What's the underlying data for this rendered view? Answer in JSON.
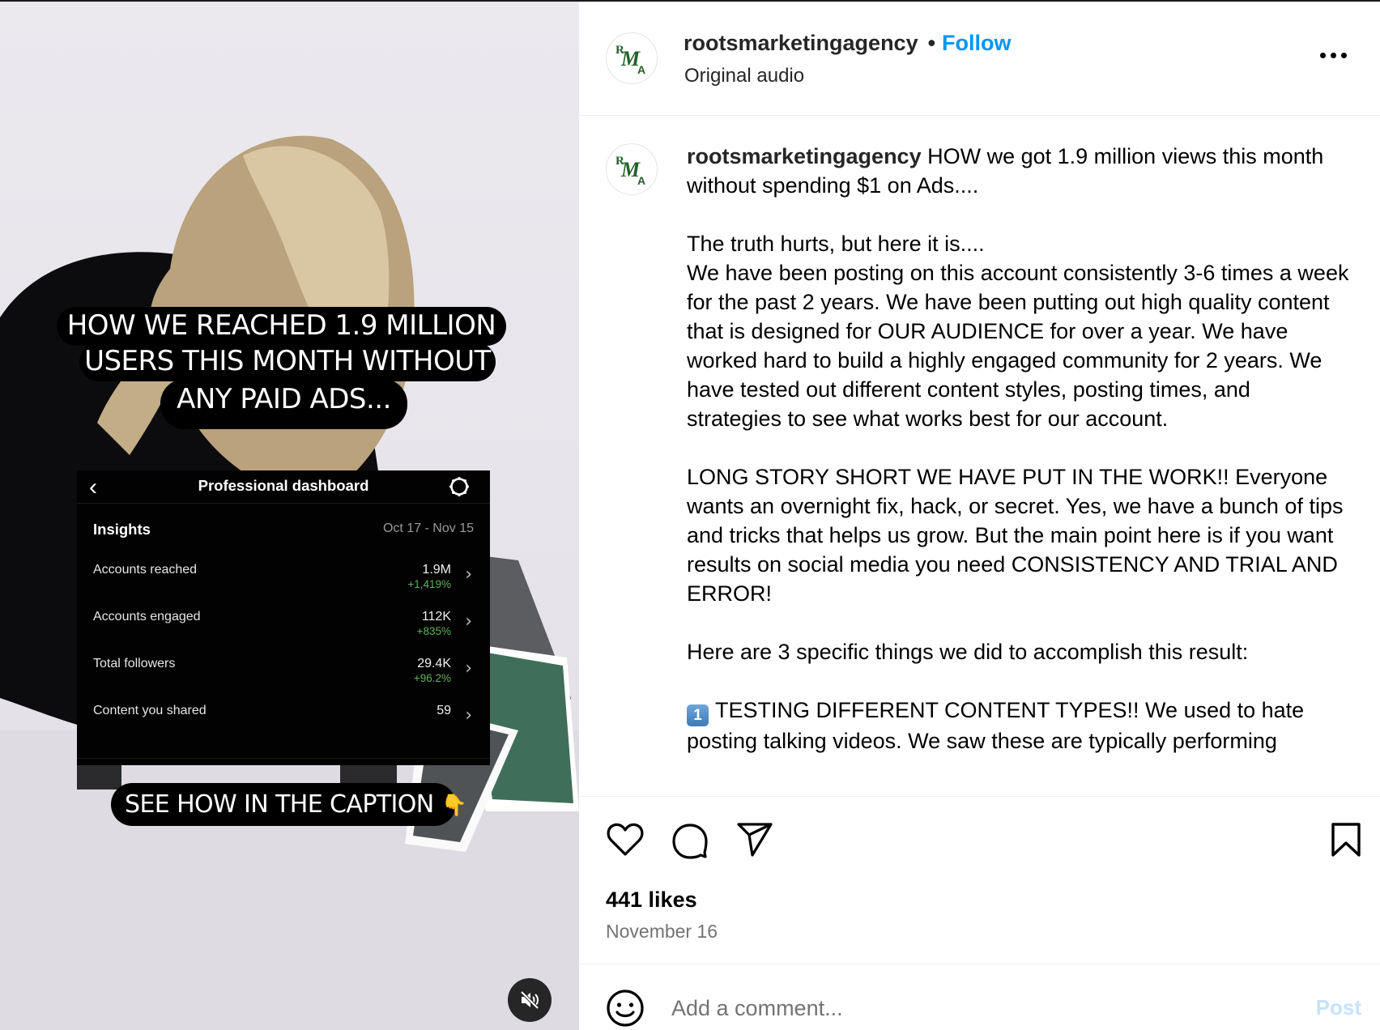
{
  "video": {
    "overlay_headline": [
      "HOW WE REACHED 1.9 MILLION",
      "USERS THIS MONTH WITHOUT",
      "ANY PAID ADS..."
    ],
    "overlay_cta": "SEE HOW IN THE CAPTION",
    "overlay_cta_emoji": "👇",
    "dashboard": {
      "title": "Professional dashboard",
      "back_icon": "‹",
      "section": "Insights",
      "date_range": "Oct 17 - Nov 15",
      "rows": [
        {
          "label": "Accounts reached",
          "value": "1.9M",
          "change": "+1,419%"
        },
        {
          "label": "Accounts engaged",
          "value": "112K",
          "change": "+835%"
        },
        {
          "label": "Total followers",
          "value": "29.4K",
          "change": "+96.2%"
        },
        {
          "label": "Content you shared",
          "value": "59",
          "change": ""
        }
      ],
      "chevron": "›",
      "positive_color": "#5fb25a"
    },
    "mute_state": "muted"
  },
  "header": {
    "username": "rootsmarketingagency",
    "separator": "•",
    "follow_label": "Follow",
    "subtitle": "Original audio",
    "avatar_initials": "RMA",
    "accent_color": "#0095f6"
  },
  "caption": {
    "username": "rootsmarketingagency",
    "intro": "HOW we got 1.9 million views this month without spending $1 on Ads....",
    "p1": "The truth hurts, but here it is....",
    "p2": "We have been posting on this account consistently 3-6 times a week for the past 2 years. We have been putting out high quality content that is designed for OUR AUDIENCE for over a year. We have worked hard to build a highly engaged community for 2 years. We have tested out different content styles, posting times, and strategies to see what works best for our account.",
    "p3": "LONG STORY SHORT WE HAVE PUT IN THE WORK!! Everyone wants an overnight fix, hack, or secret. Yes, we have a bunch of tips and tricks that helps us grow. But the main point here is if you want results on social media you need CONSISTENCY AND TRIAL AND ERROR!",
    "p4": "Here are 3 specific things we did to accomplish this result:",
    "item1_key": "1",
    "item1": "TESTING DIFFERENT CONTENT TYPES!! We used to hate posting talking videos. We saw these are typically performing"
  },
  "actions": {
    "icons": [
      "heart-icon",
      "comment-icon",
      "share-icon",
      "bookmark-icon"
    ],
    "likes": "441 likes",
    "date": "November 16"
  },
  "comment": {
    "placeholder": "Add a comment...",
    "value": "",
    "post_label": "Post",
    "post_color_disabled": "#c7e2fb"
  }
}
